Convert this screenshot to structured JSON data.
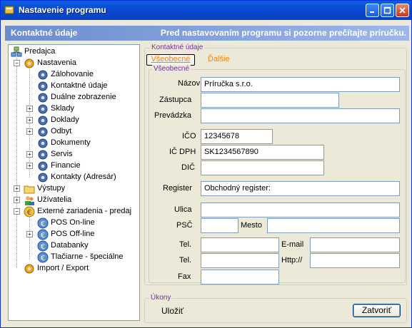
{
  "window": {
    "title": "Nastavenie programu"
  },
  "header": {
    "left": "Kontaktné údaje",
    "right": "Pred nastavovaním programu si pozorne prečítajte príručku."
  },
  "tree": {
    "root": "Predajca",
    "nastavenia": "Nastavenia",
    "zalohovanie": "Zálohovanie",
    "kontaktne": "Kontaktné údaje",
    "dualne": "Duálne zobrazenie",
    "sklady": "Sklady",
    "doklady": "Doklady",
    "odbyt": "Odbyt",
    "dokumenty": "Dokumenty",
    "servis": "Servis",
    "financie": "Financie",
    "kontakty": "Kontakty (Adresár)",
    "vystupy": "Výstupy",
    "uzivatelia": "Užívatelia",
    "externe": "Externé zariadenia - predaj",
    "pos_online": "POS On-line",
    "pos_offline": "POS Off-line",
    "databanky": "Databanky",
    "tlaciarne": "Tlačiarne - špeciálne",
    "import": "Import / Export"
  },
  "panel": {
    "group_label": "Kontaktné údaje",
    "tab_vseobecne": "Všeobecné",
    "tab_dalsie": "Ďalšie",
    "inner_label": "Všeobecné"
  },
  "labels": {
    "nazov": "Názov",
    "zastupca": "Zástupca",
    "prevadzka": "Prevádzka",
    "ico": "IČO",
    "icdph": "IČ DPH",
    "dic": "DIČ",
    "register": "Register",
    "ulica": "Ulica",
    "psc": "PSČ",
    "mesto": "Mesto",
    "tel1": "Tel.",
    "tel2": "Tel.",
    "fax": "Fax",
    "email": "E-mail",
    "http": "Http://"
  },
  "values": {
    "nazov": "Príručka s.r.o.",
    "zastupca": "",
    "prevadzka": "",
    "ico": "12345678",
    "icdph": "SK1234567890",
    "dic": "",
    "register": "Obchodný register:",
    "ulica": "",
    "psc": "",
    "mesto": "",
    "tel1": "",
    "tel2": "",
    "fax": "",
    "email": "",
    "http": ""
  },
  "actions": {
    "group_label": "Úkony",
    "save": "Uložiť",
    "close": "Zatvoriť"
  }
}
